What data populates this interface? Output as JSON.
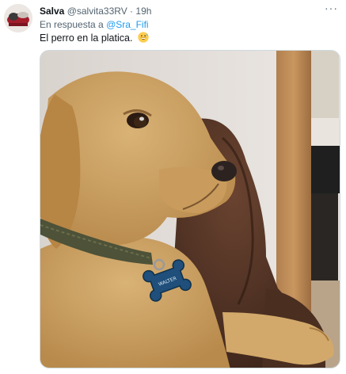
{
  "tweet": {
    "display_name": "Salva",
    "handle": "@salvita33RV",
    "separator": "·",
    "time": "19h",
    "more_label": "···",
    "reply_prefix": "En respuesta a",
    "reply_to": "@Sra_Fifi",
    "text": "El perro en la platica.",
    "emoji": "grinning-face-with-sweat-emoji"
  },
  "media": {
    "tag_text": "WALTER"
  },
  "colors": {
    "link": "#1d9bf0",
    "secondary_text": "#536471",
    "primary_text": "#0f1419",
    "border": "#cfd9de"
  }
}
